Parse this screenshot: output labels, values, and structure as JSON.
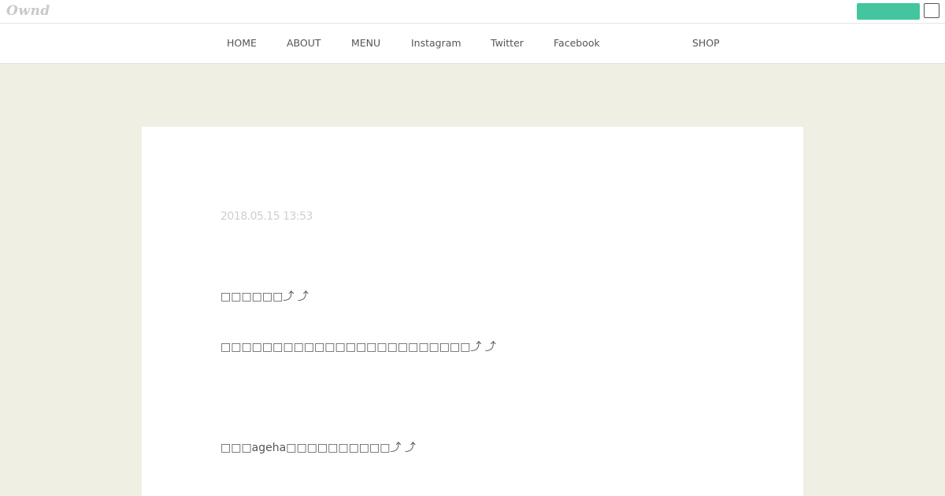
{
  "topbar": {
    "logo": "Ownd",
    "primary_button_color": "#43c6a0"
  },
  "nav": {
    "items": [
      {
        "label": "HOME"
      },
      {
        "label": "ABOUT"
      },
      {
        "label": "MENU"
      },
      {
        "label": "Instagram"
      },
      {
        "label": "Twitter"
      },
      {
        "label": "Facebook"
      },
      {
        "label": "SHOP"
      }
    ]
  },
  "post": {
    "date": "2018.05.15 13:53",
    "lines": [
      "□□□□□□⤴ ⤴",
      "□□□□□□□□□□□□□□□□□□□□□□□□⤴ ⤴",
      "□□□ageha□□□□□□□□□□⤴ ⤴"
    ]
  },
  "colors": {
    "page_background": "#efefe3",
    "card_background": "#ffffff",
    "text": "#555555",
    "date_text": "#cfcfcf"
  }
}
